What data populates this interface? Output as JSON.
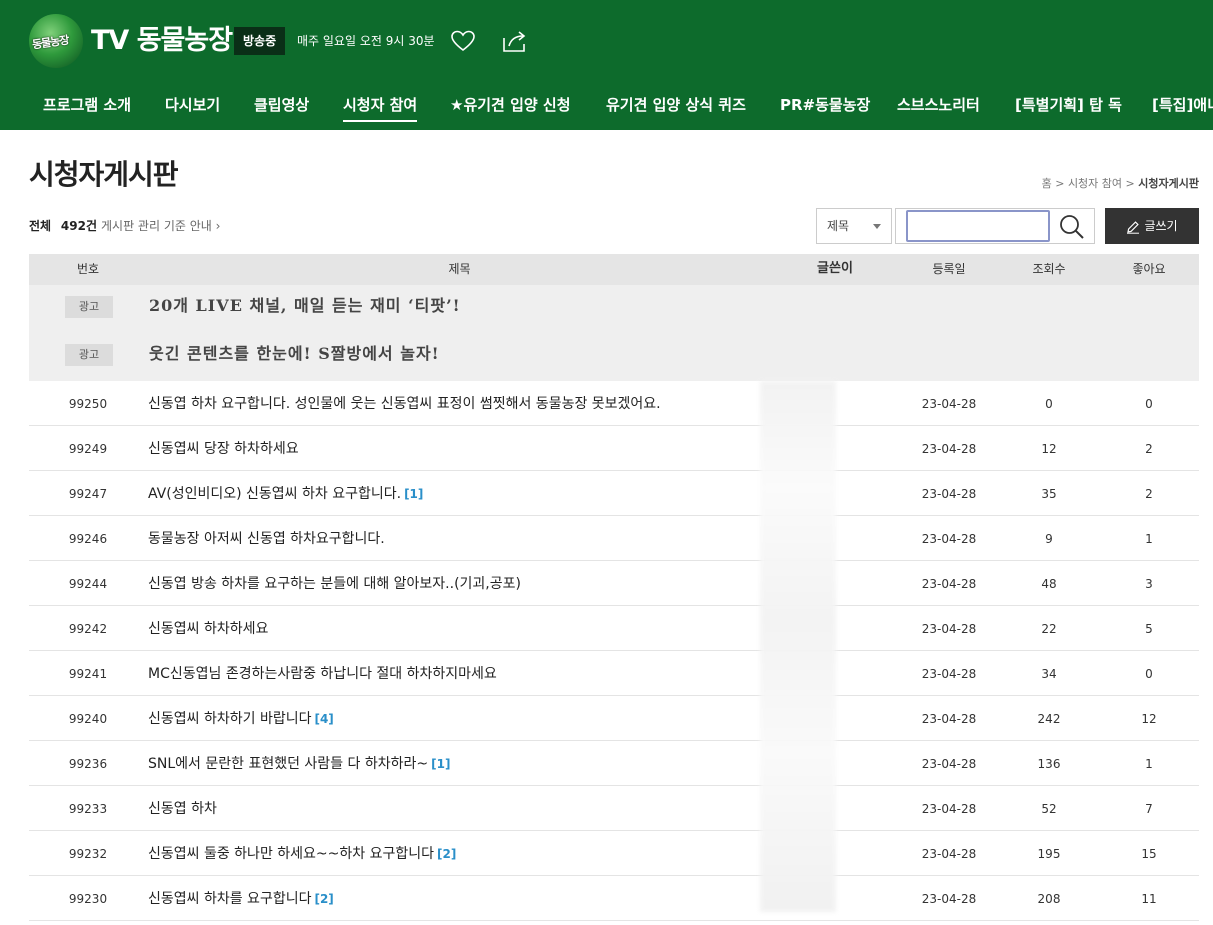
{
  "header": {
    "logo_text": "동물농장",
    "title": "TV 동물농장",
    "badge": "방송중",
    "schedule": "매주 일요일 오전 9시 30분",
    "colors": {
      "brand": "#0d6b2c",
      "badge_bg": "#0a2f17"
    },
    "icons": [
      "heart-icon",
      "share-icon"
    ]
  },
  "nav": {
    "items": [
      {
        "label": "프로그램 소개"
      },
      {
        "label": "다시보기"
      },
      {
        "label": "클립영상"
      },
      {
        "label": "시청자 참여",
        "active": true
      },
      {
        "label": "★유기견 입양 신청"
      },
      {
        "label": "유기견 입양 상식 퀴즈"
      },
      {
        "label": "PR#동물농장"
      },
      {
        "label": "스브스노리터"
      },
      {
        "label": "[특별기획] 탑 독"
      },
      {
        "label": "[특집]애니"
      }
    ]
  },
  "page": {
    "title": "시청자게시판",
    "breadcrumb": [
      "홈",
      "시청자 참여",
      "시청자게시판"
    ],
    "total_label": "전체",
    "total_count": "492건",
    "guide_link": "게시판 관리 기준 안내"
  },
  "search": {
    "select_value": "제목",
    "input_value": "",
    "write_label": "글쓰기"
  },
  "table": {
    "headers": {
      "num": "번호",
      "title": "제목",
      "writer": "글쓴이",
      "date": "등록일",
      "views": "조회수",
      "likes": "좋아요"
    },
    "ads": [
      {
        "badge": "광고",
        "text": "20개 LIVE 채널, 매일 듣는 재미 ‘티팟’!"
      },
      {
        "badge": "광고",
        "text": "웃긴 콘텐츠를 한눈에! S짤방에서 놀자!"
      }
    ],
    "rows": [
      {
        "num": "99250",
        "title": "신동엽 하차 요구합니다. 성인물에 웃는 신동엽씨 표정이 썸찟해서 동물농장 못보겠어요.",
        "comments": "",
        "date": "23-04-28",
        "views": "0",
        "likes": "0"
      },
      {
        "num": "99249",
        "title": "신동엽씨 당장 하차하세요",
        "comments": "",
        "date": "23-04-28",
        "views": "12",
        "likes": "2"
      },
      {
        "num": "99247",
        "title": "AV(성인비디오) 신동엽씨 하차 요구합니다.",
        "comments": "[1]",
        "date": "23-04-28",
        "views": "35",
        "likes": "2"
      },
      {
        "num": "99246",
        "title": "동물농장 아저씨 신동엽 하차요구합니다.",
        "comments": "",
        "date": "23-04-28",
        "views": "9",
        "likes": "1"
      },
      {
        "num": "99244",
        "title": "신동엽 방송 하차를 요구하는 분들에 대해 알아보자..(기괴,공포)",
        "comments": "",
        "date": "23-04-28",
        "views": "48",
        "likes": "3"
      },
      {
        "num": "99242",
        "title": "신동엽씨 하차하세요",
        "comments": "",
        "date": "23-04-28",
        "views": "22",
        "likes": "5"
      },
      {
        "num": "99241",
        "title": "MC신동엽님 존경하는사람중 하납니다 절대 하차하지마세요",
        "comments": "",
        "date": "23-04-28",
        "views": "34",
        "likes": "0"
      },
      {
        "num": "99240",
        "title": "신동엽씨 하차하기 바랍니다",
        "comments": "[4]",
        "date": "23-04-28",
        "views": "242",
        "likes": "12"
      },
      {
        "num": "99236",
        "title": "SNL에서 문란한 표현했던 사람들 다 하차하라~",
        "comments": "[1]",
        "date": "23-04-28",
        "views": "136",
        "likes": "1"
      },
      {
        "num": "99233",
        "title": "신동엽 하차",
        "comments": "",
        "date": "23-04-28",
        "views": "52",
        "likes": "7"
      },
      {
        "num": "99232",
        "title": "신동엽씨 둘중 하나만 하세요~~하차 요구합니다",
        "comments": "[2]",
        "date": "23-04-28",
        "views": "195",
        "likes": "15"
      },
      {
        "num": "99230",
        "title": "신동엽씨 하차를 요구합니다",
        "comments": "[2]",
        "date": "23-04-28",
        "views": "208",
        "likes": "11"
      }
    ]
  }
}
